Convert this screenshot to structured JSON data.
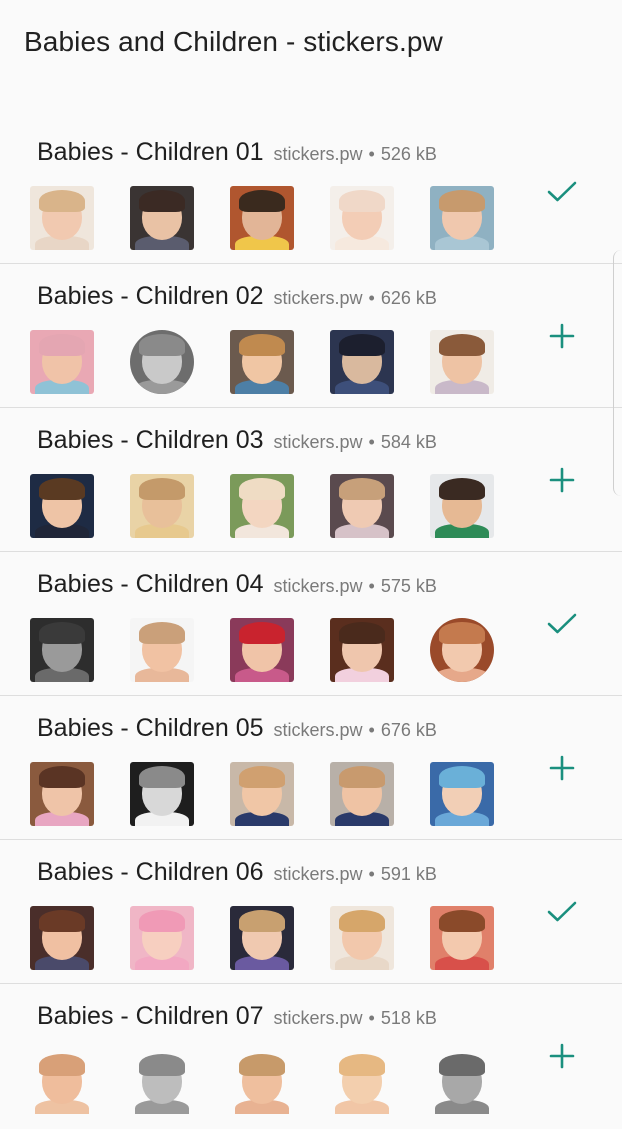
{
  "app": {
    "title": "Babies and Children - stickers.pw"
  },
  "packs": [
    {
      "name": "Babies - Children 01",
      "publisher": "stickers.pw",
      "size": "526 kB",
      "added": true,
      "thumbs": [
        {
          "bg": "#efe6dc",
          "skin": "#f1c9b0",
          "hair": "#d9b48a",
          "body": "#e8d6c6",
          "round": false
        },
        {
          "bg": "#3a3433",
          "skin": "#e9c2a5",
          "hair": "#3b2a24",
          "body": "#5a5c6e",
          "round": false
        },
        {
          "bg": "#b0562f",
          "skin": "#e2b597",
          "hair": "#3a2a1e",
          "body": "#f0c64a",
          "round": false
        },
        {
          "bg": "#f4efea",
          "skin": "#f3cdb6",
          "hair": "#f0d8c8",
          "body": "#f6e9de",
          "round": false
        },
        {
          "bg": "#8fb1c2",
          "skin": "#f0c8ae",
          "hair": "#c79a6d",
          "body": "#a9c6d4",
          "round": false
        }
      ]
    },
    {
      "name": "Babies - Children 02",
      "publisher": "stickers.pw",
      "size": "626 kB",
      "added": false,
      "thumbs": [
        {
          "bg": "#e9a8b4",
          "skin": "#f0c3a8",
          "hair": "#e4a6b2",
          "body": "#8fc2d6",
          "round": false
        },
        {
          "bg": "#6d6d6d",
          "skin": "#c9c9c9",
          "hair": "#8a8a8a",
          "body": "#9a9a9a",
          "round": true
        },
        {
          "bg": "#6b5a4e",
          "skin": "#f0c6a4",
          "hair": "#c08a4f",
          "body": "#4d7fa6",
          "round": false
        },
        {
          "bg": "#2c3550",
          "skin": "#d9b99e",
          "hair": "#1c1f2e",
          "body": "#3d4f7a",
          "round": false
        },
        {
          "bg": "#f0ece6",
          "skin": "#eec3a4",
          "hair": "#8a5a3a",
          "body": "#c9b9c9",
          "round": false
        }
      ]
    },
    {
      "name": "Babies - Children 03",
      "publisher": "stickers.pw",
      "size": "584 kB",
      "added": false,
      "thumbs": [
        {
          "bg": "#1e2b44",
          "skin": "#eec4a6",
          "hair": "#5a3a22",
          "body": "#202638",
          "round": false
        },
        {
          "bg": "#e9d3a6",
          "skin": "#e8c09a",
          "hair": "#c49a6a",
          "body": "#e7c98e",
          "round": false
        },
        {
          "bg": "#7b9a5a",
          "skin": "#f3d6c1",
          "hair": "#efdcc4",
          "body": "#f2e6dc",
          "round": false
        },
        {
          "bg": "#5a4a4e",
          "skin": "#efcab3",
          "hair": "#c7a07a",
          "body": "#d6c2c8",
          "round": false
        },
        {
          "bg": "#e6e8ea",
          "skin": "#e6b994",
          "hair": "#3a2a22",
          "body": "#2e8b57",
          "round": false
        }
      ]
    },
    {
      "name": "Babies - Children 04",
      "publisher": "stickers.pw",
      "size": "575 kB",
      "added": true,
      "thumbs": [
        {
          "bg": "#2d2d2d",
          "skin": "#9a9a9a",
          "hair": "#3a3a3a",
          "body": "#6a6a6a",
          "round": false
        },
        {
          "bg": "#f5f5f5",
          "skin": "#f1c2a3",
          "hair": "#caa07a",
          "body": "#e8b89a",
          "round": false
        },
        {
          "bg": "#8a3a5a",
          "skin": "#f0c4a8",
          "hair": "#c9232e",
          "body": "#c85a8a",
          "round": false
        },
        {
          "bg": "#5a2e1e",
          "skin": "#efc6ad",
          "hair": "#4a2a1c",
          "body": "#f2d0de",
          "round": false
        },
        {
          "bg": "#9a4a2a",
          "skin": "#f2c9ae",
          "hair": "#c47a4e",
          "body": "#e6a88a",
          "round": true
        }
      ]
    },
    {
      "name": "Babies - Children 05",
      "publisher": "stickers.pw",
      "size": "676 kB",
      "added": false,
      "thumbs": [
        {
          "bg": "#8a5a3e",
          "skin": "#efc4a8",
          "hair": "#5a3424",
          "body": "#e8a6c2",
          "round": false
        },
        {
          "bg": "#1e1e1e",
          "skin": "#d8d8d8",
          "hair": "#8a8a8a",
          "body": "#f2f2f2",
          "round": false
        },
        {
          "bg": "#c8b8a8",
          "skin": "#f0c6a6",
          "hair": "#d0a070",
          "body": "#2a3a6a",
          "round": false
        },
        {
          "bg": "#b8b0a8",
          "skin": "#efc3a4",
          "hair": "#c89a6e",
          "body": "#2a3a6a",
          "round": false
        },
        {
          "bg": "#3a6aa8",
          "skin": "#f2cfb6",
          "hair": "#6ab0d8",
          "body": "#6aa8d8",
          "round": false
        }
      ]
    },
    {
      "name": "Babies - Children 06",
      "publisher": "stickers.pw",
      "size": "591 kB",
      "added": true,
      "thumbs": [
        {
          "bg": "#4a2e2a",
          "skin": "#f0c0a2",
          "hair": "#6a3a26",
          "body": "#4a4a6a",
          "round": false
        },
        {
          "bg": "#f0b6c6",
          "skin": "#f7cfc0",
          "hair": "#f09ab6",
          "body": "#f2a8c2",
          "round": false
        },
        {
          "bg": "#2a2a3a",
          "skin": "#f0c9b0",
          "hair": "#c8a070",
          "body": "#6a5aa0",
          "round": false
        },
        {
          "bg": "#efe6dc",
          "skin": "#f2c8ac",
          "hair": "#d6a66a",
          "body": "#e8d8c8",
          "round": false
        },
        {
          "bg": "#e0806a",
          "skin": "#f3c9ae",
          "hair": "#8a4a2a",
          "body": "#d8504a",
          "round": false
        }
      ]
    },
    {
      "name": "Babies - Children 07",
      "publisher": "stickers.pw",
      "size": "518 kB",
      "added": false,
      "thumbs": [
        {
          "bg": "#fafafa",
          "skin": "#efbd9c",
          "hair": "#d8a078",
          "body": "#eec2a2",
          "round": false
        },
        {
          "bg": "#fafafa",
          "skin": "#bdbdbd",
          "hair": "#8a8a8a",
          "body": "#9a9a9a",
          "round": false
        },
        {
          "bg": "#fafafa",
          "skin": "#efbf9e",
          "hair": "#c79a6a",
          "body": "#e8b292",
          "round": false
        },
        {
          "bg": "#fafafa",
          "skin": "#f3cfae",
          "hair": "#e6b882",
          "body": "#f1c6a6",
          "round": false
        },
        {
          "bg": "#fafafa",
          "skin": "#a8a8a8",
          "hair": "#6a6a6a",
          "body": "#8a8a8a",
          "round": false
        }
      ]
    }
  ],
  "icons": {
    "added": "check-icon",
    "not_added": "plus-icon"
  },
  "colors": {
    "accent": "#1a8f7e",
    "divider": "#dedede",
    "background": "#fafafa"
  }
}
